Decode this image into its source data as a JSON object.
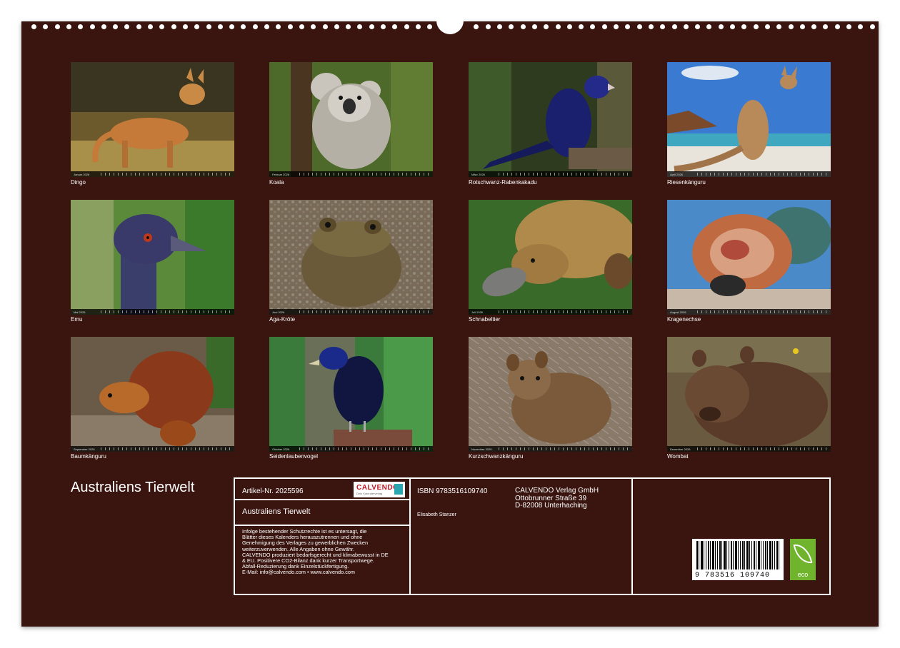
{
  "photos": [
    {
      "caption": "Dingo",
      "month": "Januar 2026",
      "subject": "dingo"
    },
    {
      "caption": "Koala",
      "month": "Februar 2026",
      "subject": "koala"
    },
    {
      "caption": "Rotschwanz-Rabenkakadu",
      "month": "März 2026",
      "subject": "black-cockatoo"
    },
    {
      "caption": "Riesenkänguru",
      "month": "April 2026",
      "subject": "kangaroo"
    },
    {
      "caption": "Emu",
      "month": "Mai 2026",
      "subject": "emu"
    },
    {
      "caption": "Aga-Kröte",
      "month": "Juni 2026",
      "subject": "cane-toad"
    },
    {
      "caption": "Schnabeltier",
      "month": "Juli 2026",
      "subject": "platypus"
    },
    {
      "caption": "Kragenechse",
      "month": "August 2026",
      "subject": "frilled-lizard"
    },
    {
      "caption": "Baumkänguru",
      "month": "September 2026",
      "subject": "tree-kangaroo"
    },
    {
      "caption": "Seidenlaubenvogel",
      "month": "Oktober 2026",
      "subject": "bowerbird"
    },
    {
      "caption": "Kurzschwanzkänguru",
      "month": "November 2026",
      "subject": "quokka"
    },
    {
      "caption": "Wombat",
      "month": "Dezember 2026",
      "subject": "wombat"
    }
  ],
  "title": "Australiens Tierwelt",
  "info": {
    "article": "Artikel-Nr. 2025596",
    "title": "Australiens Tierwelt",
    "legal_lines": [
      "Infolge bestehender Schutzrechte ist es untersagt, die",
      "Blätter dieses Kalenders herauszutrennen und ohne",
      "Genehmigung des Verlages zu gewerblichen Zwecken",
      "weiterzuverwenden. Alle Angaben ohne Gewähr.",
      "CALVENDO produziert bedarfsgerecht und klimabewusst in DE",
      "& EU. Positivere CO2-Bilanz dank kurzer Transportwege.",
      "Abfall-Reduzierung dank Einzelstückfertigung.",
      "E-Mail: info@calvendo.com • www.calvendo.com"
    ],
    "isbn": "ISBN 9783516109740",
    "author": "Elisabeth Stanzer",
    "publisher_lines": [
      "CALVENDO Verlag GmbH",
      "Ottobrunner Straße 39",
      "D-82008 Unterhaching"
    ],
    "barcode_number": "9 783516 109740",
    "logo_name": "CALVENDO",
    "logo_sub": "Dein Kalenderverlag",
    "eco_label": "eco"
  },
  "colors": {
    "background": "#3a1510",
    "text": "#ffffff"
  }
}
